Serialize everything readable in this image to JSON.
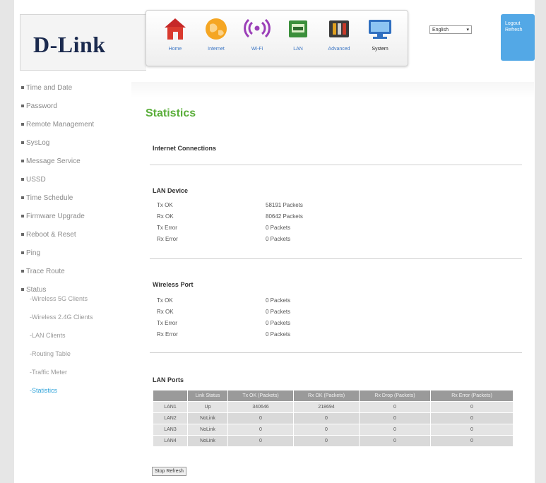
{
  "brand": "D-Link",
  "nav": {
    "items": [
      {
        "label": "Home"
      },
      {
        "label": "Internet"
      },
      {
        "label": "Wi-Fi"
      },
      {
        "label": "LAN"
      },
      {
        "label": "Advanced"
      },
      {
        "label": "System"
      }
    ],
    "active": "System"
  },
  "language": {
    "selected": "English"
  },
  "session": {
    "logout": "Logout",
    "refresh": "Refresh"
  },
  "sidebar": {
    "items": [
      "Time and Date",
      "Password",
      "Remote Management",
      "SysLog",
      "Message Service",
      "USSD",
      "Time Schedule",
      "Firmware Upgrade",
      "Reboot & Reset",
      "Ping",
      "Trace Route",
      "Status"
    ],
    "status_subitems": [
      "-Wireless 5G Clients",
      "-Wireless 2.4G Clients",
      "-LAN Clients",
      "-Routing Table",
      "-Traffic Meter",
      "-Statistics"
    ],
    "active_sub": "-Statistics"
  },
  "page": {
    "title": "Statistics"
  },
  "sections": {
    "internet": {
      "title": "Internet Connections"
    },
    "lan_device": {
      "title": "LAN Device",
      "rows": [
        {
          "label": "Tx OK",
          "value": "58191  Packets"
        },
        {
          "label": "Rx OK",
          "value": "80642  Packets"
        },
        {
          "label": "Tx Error",
          "value": "0  Packets"
        },
        {
          "label": "Rx Error",
          "value": "0  Packets"
        }
      ]
    },
    "wireless": {
      "title": "Wireless Port",
      "rows": [
        {
          "label": "Tx OK",
          "value": "0  Packets"
        },
        {
          "label": "Rx OK",
          "value": "0  Packets"
        },
        {
          "label": "Tx Error",
          "value": "0  Packets"
        },
        {
          "label": "Rx Error",
          "value": "0  Packets"
        }
      ]
    },
    "lan_ports": {
      "title": "LAN Ports",
      "headers": [
        "",
        "Link Status",
        "Tx OK (Packets)",
        "Rx OK (Packets)",
        "Rx Drop (Packets)",
        "Rx Error (Packets)"
      ],
      "rows": [
        [
          "LAN1",
          "Up",
          "340646",
          "218694",
          "0",
          "0"
        ],
        [
          "LAN2",
          "NoLink",
          "0",
          "0",
          "0",
          "0"
        ],
        [
          "LAN3",
          "NoLink",
          "0",
          "0",
          "0",
          "0"
        ],
        [
          "LAN4",
          "NoLink",
          "0",
          "0",
          "0",
          "0"
        ]
      ]
    }
  },
  "buttons": {
    "stop_refresh": "Stop Refresh"
  }
}
